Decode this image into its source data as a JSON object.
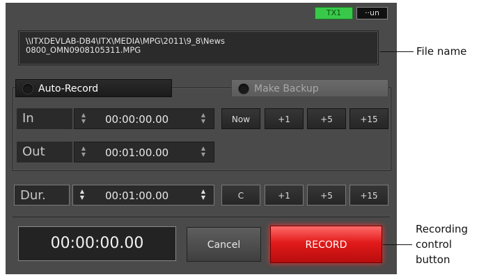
{
  "status_tags": {
    "green": "TX1",
    "black": "··un"
  },
  "file_path": {
    "line1": "\\\\ITXDEVLAB-DB4\\ITX\\MEDIA\\MPG\\2011\\9_8\\News",
    "line2": "0800_OMN0908105311.MPG"
  },
  "tabs": {
    "auto_record": "Auto-Record",
    "make_backup": "Make Backup"
  },
  "in_row": {
    "label": "In",
    "time": "00:00:00.00"
  },
  "out_row": {
    "label": "Out",
    "time": "00:01:00.00"
  },
  "in_buttons": [
    "Now",
    "+1",
    "+5",
    "+15"
  ],
  "dur_row": {
    "label": "Dur.",
    "time": "00:01:00.00"
  },
  "dur_buttons": [
    "C",
    "+1",
    "+5",
    "+15"
  ],
  "bottom": {
    "timecode": "00:00:00.00",
    "cancel": "Cancel",
    "record": "RECORD"
  },
  "annotations": {
    "file_name": "File name",
    "recording_line1": "Recording",
    "recording_line2": "control",
    "recording_line3": "button"
  }
}
